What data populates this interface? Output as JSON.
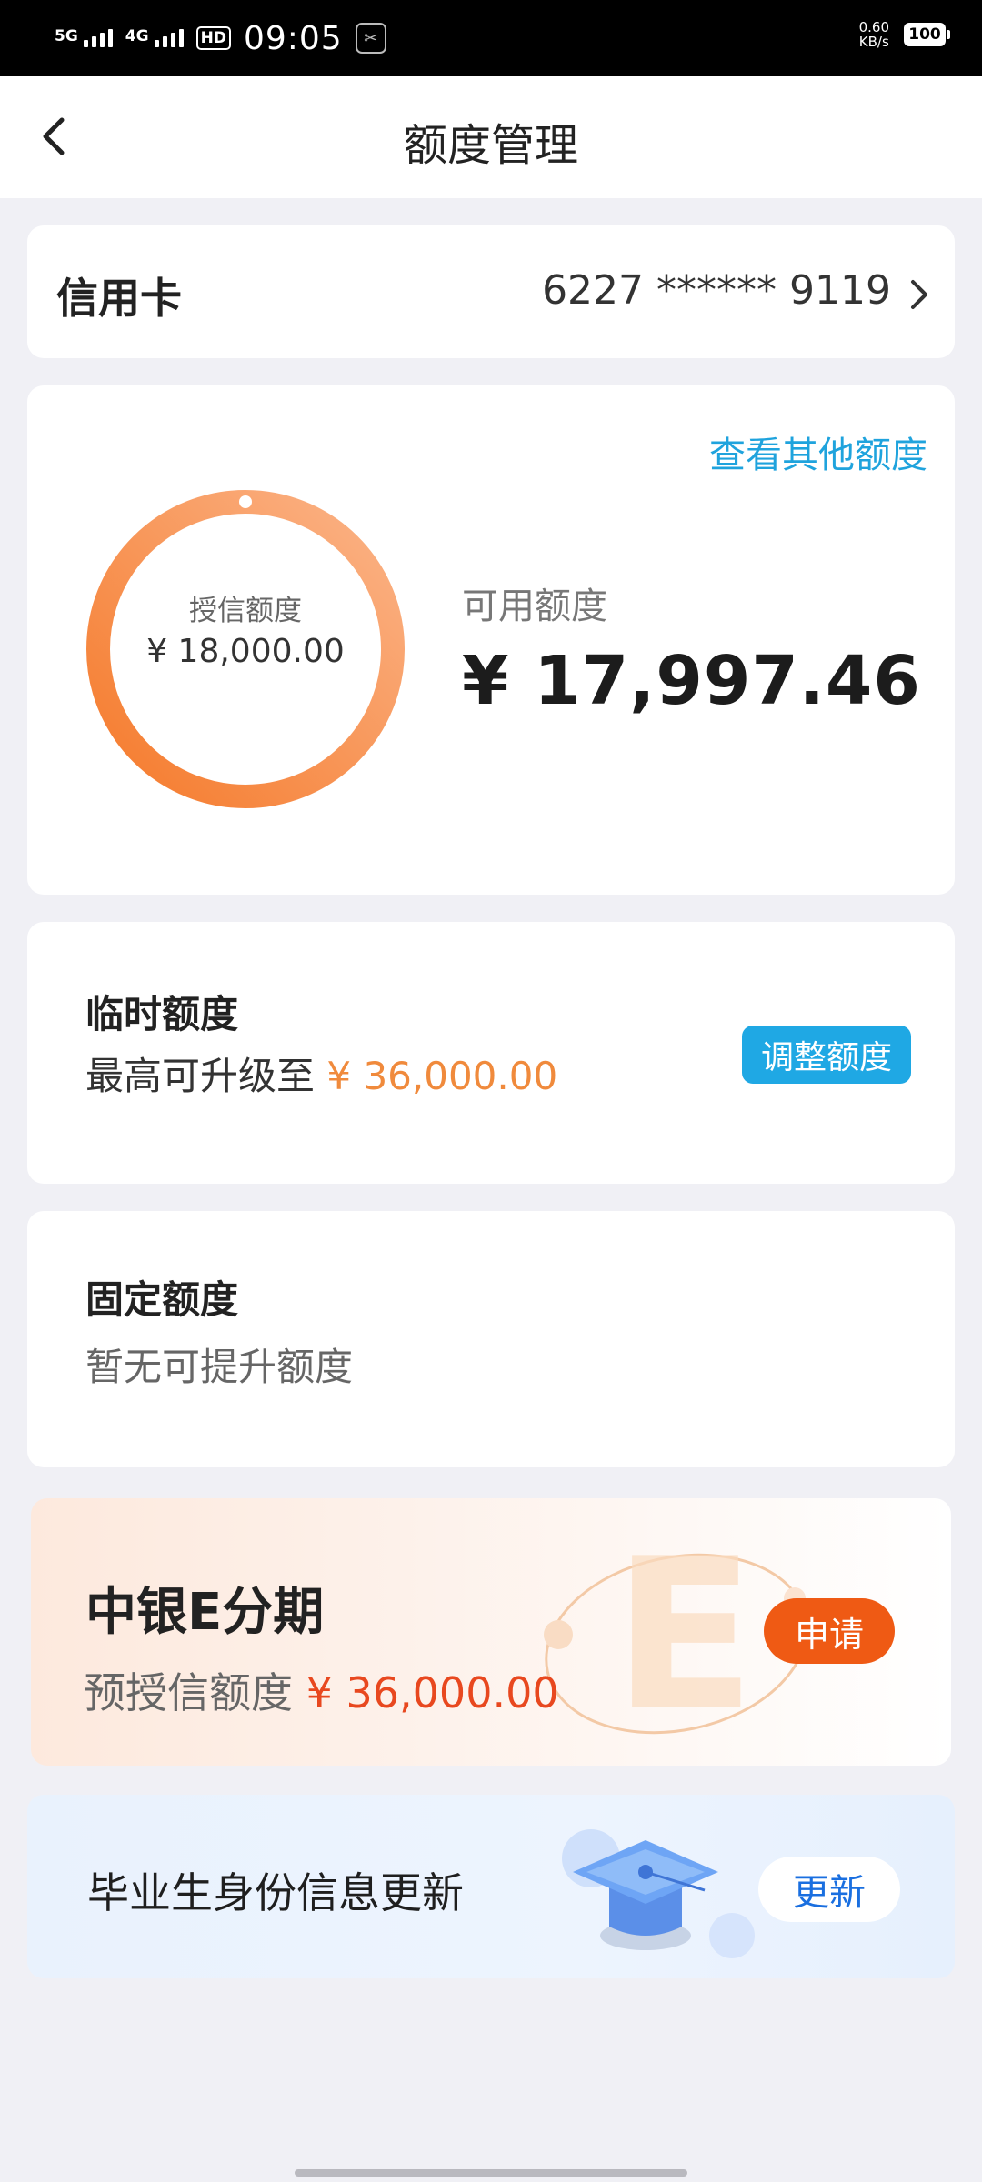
{
  "status_bar": {
    "signal1": "5G",
    "signal2": "4G",
    "hd": "HD",
    "time": "09:05",
    "speed_value": "0.60",
    "speed_unit": "KB/s",
    "battery": "100"
  },
  "nav": {
    "back_icon": "chevron-left-icon",
    "title": "额度管理"
  },
  "card_row": {
    "label": "信用卡",
    "number": "6227 ****** 9119",
    "icon": "chevron-right-icon"
  },
  "credit": {
    "other_link": "查看其他额度",
    "granted_label": "授信额度",
    "granted_value": "¥ 18,000.00",
    "available_label": "可用额度",
    "available_value": "¥ 17,997.46",
    "ring_color_start": "#f57a2b",
    "ring_color_end": "#fbb488"
  },
  "temporary": {
    "title": "临时额度",
    "prefix": "最高可升级至",
    "amount": "¥ 36,000.00",
    "button": "调整额度"
  },
  "fixed": {
    "title": "固定额度",
    "sub": "暂无可提升额度"
  },
  "installment": {
    "title": "中银E分期",
    "prefix": "预授信额度",
    "amount": "¥ 36,000.00",
    "button": "申请",
    "deco_letter": "E"
  },
  "graduate": {
    "title": "毕业生身份信息更新",
    "button": "更新",
    "icon": "graduation-cap-icon"
  },
  "colors": {
    "accent_blue": "#1fa8e4",
    "accent_orange": "#f08a3c",
    "apply_orange": "#ef5a14",
    "installment_red": "#e8481f"
  }
}
